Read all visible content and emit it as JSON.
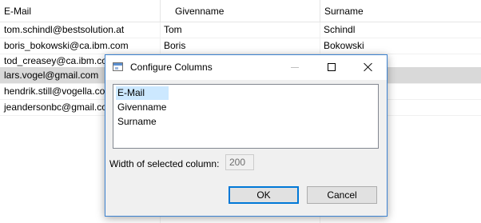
{
  "table": {
    "columns": [
      "E-Mail",
      "Givenname",
      "Surname"
    ],
    "rows": [
      {
        "email": "tom.schindl@bestsolution.at",
        "givenname": "Tom",
        "surname": "Schindl"
      },
      {
        "email": "boris_bokowski@ca.ibm.com",
        "givenname": "Boris",
        "surname": "Bokowski"
      },
      {
        "email": "tod_creasey@ca.ibm.com",
        "givenname": "",
        "surname": ""
      },
      {
        "email": "lars.vogel@gmail.com",
        "givenname": "",
        "surname": ""
      },
      {
        "email": "hendrik.still@vogella.com",
        "givenname": "",
        "surname": ""
      },
      {
        "email": "jeandersonbc@gmail.com",
        "givenname": "",
        "surname": ""
      }
    ],
    "selected_row": 3
  },
  "dialog": {
    "title": "Configure Columns",
    "icon": "app-window-icon",
    "window_controls": [
      "minimize-icon",
      "maximize-icon",
      "close-icon"
    ],
    "columns_list": [
      "E-Mail",
      "Givenname",
      "Surname"
    ],
    "selected_column": "E-Mail",
    "width_label": "Width of selected column:",
    "width_value": "200",
    "ok_label": "OK",
    "cancel_label": "Cancel"
  },
  "colors": {
    "selection_row": "#d9d9d9",
    "list_selection": "#cce8ff",
    "dialog_border": "#3d83d1",
    "default_button_border": "#0078d7"
  }
}
